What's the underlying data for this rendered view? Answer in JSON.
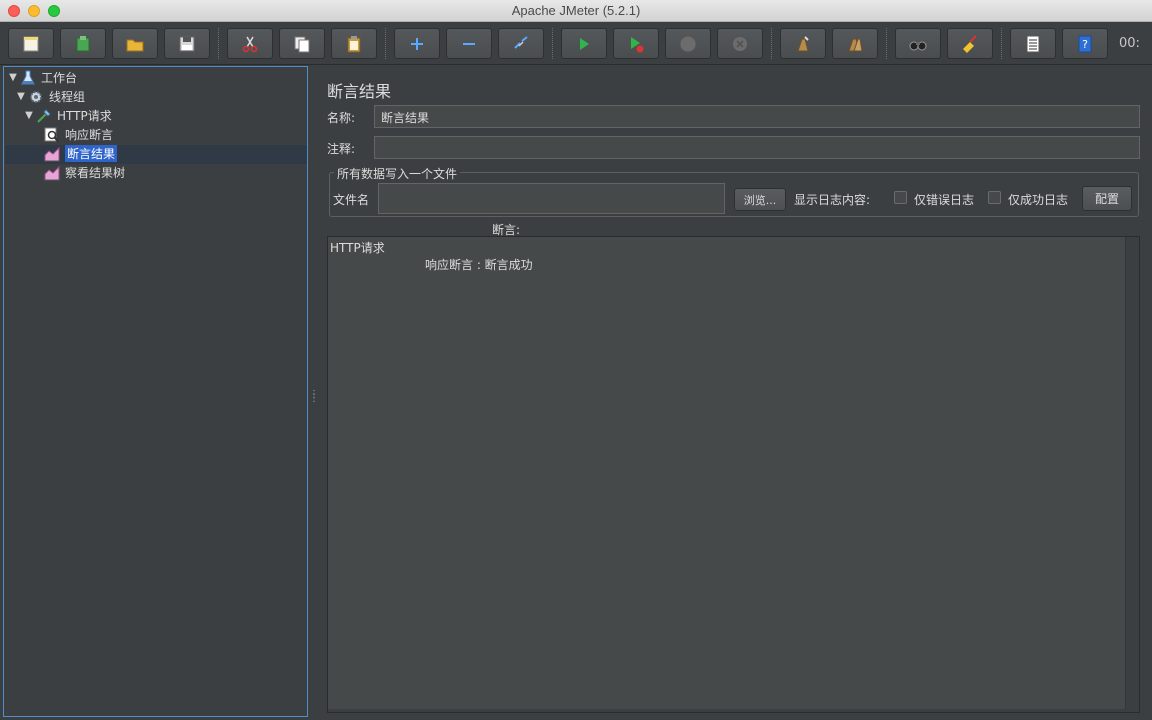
{
  "window": {
    "title": "Apache JMeter (5.2.1)"
  },
  "toolbar": {
    "buttons": [
      {
        "name": "new-icon"
      },
      {
        "name": "templates-icon"
      },
      {
        "name": "open-icon"
      },
      {
        "name": "save-icon"
      },
      {
        "name": "cut-icon"
      },
      {
        "name": "copy-icon"
      },
      {
        "name": "paste-icon"
      },
      {
        "name": "expand-icon"
      },
      {
        "name": "collapse-icon"
      },
      {
        "name": "toggle-icon"
      },
      {
        "name": "start-icon"
      },
      {
        "name": "start-no-pause-icon"
      },
      {
        "name": "stop-icon"
      },
      {
        "name": "shutdown-icon"
      },
      {
        "name": "clear-icon"
      },
      {
        "name": "clear-all-icon"
      },
      {
        "name": "search-icon"
      },
      {
        "name": "reset-search-icon"
      },
      {
        "name": "function-helper-icon"
      },
      {
        "name": "help-icon"
      }
    ],
    "timer": "00:"
  },
  "tree": {
    "nodes": [
      {
        "label": "工作台",
        "icon": "test-plan-icon"
      },
      {
        "label": "线程组",
        "icon": "thread-group-icon"
      },
      {
        "label": "HTTP请求",
        "icon": "http-sampler-icon"
      },
      {
        "label": "响应断言",
        "icon": "response-assertion-icon"
      },
      {
        "label": "断言结果",
        "icon": "assertion-results-icon",
        "selected": true
      },
      {
        "label": "察看结果树",
        "icon": "view-results-tree-icon"
      }
    ]
  },
  "panel": {
    "title": "断言结果",
    "name_label": "名称:",
    "name_value": "断言结果",
    "comment_label": "注释:",
    "comment_value": "",
    "file_group_label": "所有数据写入一个文件",
    "filename_label": "文件名",
    "filename_value": "",
    "browse_label": "浏览...",
    "log_content_label": "显示日志内容:",
    "errors_only_label": "仅错误日志",
    "success_only_label": "仅成功日志",
    "configure_label": "配置",
    "assertions_label": "断言:",
    "results": [
      "HTTP请求",
      "响应断言 : 断言成功"
    ]
  },
  "colors": {
    "background": "#3c3f41",
    "selection": "#2f65ca",
    "tree_border": "#4f8ec9"
  }
}
